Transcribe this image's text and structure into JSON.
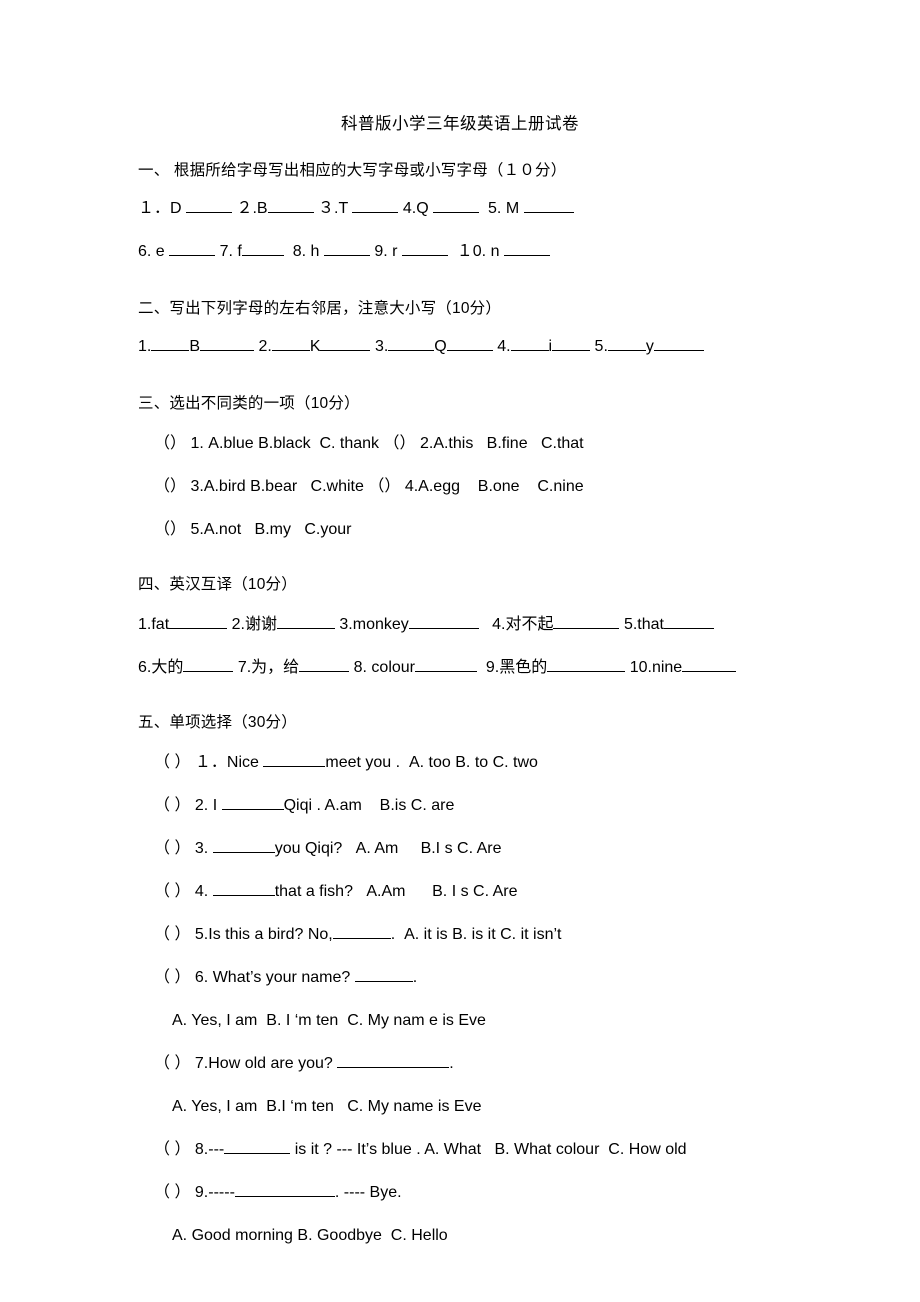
{
  "document": {
    "title": "科普版小学三年级英语上册试卷"
  },
  "sections": [
    {
      "id": "section-1",
      "heading": "一、 根据所给字母写出相应的大写字母或小写字母（１０分）",
      "rows": [
        {
          "items": [
            "１．D",
            "２.B",
            "３.T",
            "4.Q",
            "5. M"
          ]
        },
        {
          "items": [
            "6. e",
            "7. f",
            "8. h",
            "9. r",
            "１0. n"
          ]
        }
      ]
    },
    {
      "id": "section-2",
      "heading": "二、写出下列字母的左右邻居，注意大小写（10分）",
      "items": [
        "1.",
        "B",
        "2.",
        "K",
        "3.",
        "Q",
        "4.",
        "i",
        "5.",
        "y"
      ]
    },
    {
      "id": "section-3",
      "heading": "三、选出不同类的一项（10分）",
      "questions": [
        {
          "bracket": "（）",
          "num": "1.",
          "options": [
            "A.blue",
            "B.black",
            "C. thank"
          ]
        },
        {
          "bracket": "（）",
          "num": "2.",
          "options": [
            "A.this",
            "B.fine",
            "C.that"
          ]
        },
        {
          "bracket": "（）",
          "num": "3.",
          "options": [
            "A.bird",
            "B.bear",
            "C.white"
          ]
        },
        {
          "bracket": "（）",
          "num": "4.",
          "options": [
            "A.egg",
            "B.one",
            "C.nine"
          ]
        },
        {
          "bracket": "（）",
          "num": "5.",
          "options": [
            "A.not",
            "B.my",
            "C.your"
          ]
        }
      ]
    },
    {
      "id": "section-4",
      "heading": "四、英汉互译（10分）",
      "rows": [
        {
          "items": [
            "1.fat",
            "2.谢谢",
            "3.monkey",
            "4.对不起",
            "5.that"
          ]
        },
        {
          "items": [
            "6.大的",
            "7.为，给",
            "8. colour",
            "9.黑色的",
            "10.nine"
          ]
        }
      ]
    },
    {
      "id": "section-5",
      "heading": "五、单项选择（30分）",
      "questions": [
        {
          "bracket": "（ ）",
          "num": "１．",
          "stem_a": "Nice",
          "stem_b": "meet you .",
          "options": [
            "A. too",
            "B. to",
            "C. two"
          ]
        },
        {
          "bracket": "（ ）",
          "num": "2.",
          "stem_a": "I",
          "stem_b": "Qiqi .",
          "options": [
            "A.am",
            "B.is",
            "C. are"
          ]
        },
        {
          "bracket": "（ ）",
          "num": "3.",
          "stem_a": "",
          "stem_b": "you Qiqi?",
          "options": [
            "A. Am",
            "B.I s",
            "C. Are"
          ]
        },
        {
          "bracket": "（ ）",
          "num": "4.",
          "stem_a": "",
          "stem_b": "that a fish?",
          "options": [
            "A.Am",
            "B. I s",
            "C. Are"
          ]
        },
        {
          "bracket": "（ ）",
          "num": "5.",
          "stem_a": "Is this a bird? No,",
          "stem_b": ".",
          "options": [
            "A. it is",
            "B. is it",
            "C. it isn’t"
          ]
        },
        {
          "bracket": "（ ）",
          "num": "6.",
          "stem_a": "What’s your  name?",
          "stem_b": ".",
          "options": [
            "A. Yes, I am",
            "B. I ‘m ten",
            "C. My nam e is Eve"
          ]
        },
        {
          "bracket": "（ ）",
          "num": "7.",
          "stem_a": "How old are you?",
          "stem_b": ".",
          "options": [
            "A. Yes, I am",
            "B.I ‘m ten",
            "C. My name is Eve"
          ]
        },
        {
          "bracket": "（ ）",
          "num": "8.",
          "stem_a": "---",
          "stem_b": "is it ?  --- It’s blue .",
          "options": [
            "A. What",
            "B. What colour",
            "C. How old"
          ]
        },
        {
          "bracket": "（ ）",
          "num": "9.",
          "stem_a": "-----",
          "stem_b": ".   ---- Bye.",
          "options": [
            "A. Good    morning",
            "B. Goodbye",
            "C. Hello"
          ]
        }
      ]
    }
  ]
}
